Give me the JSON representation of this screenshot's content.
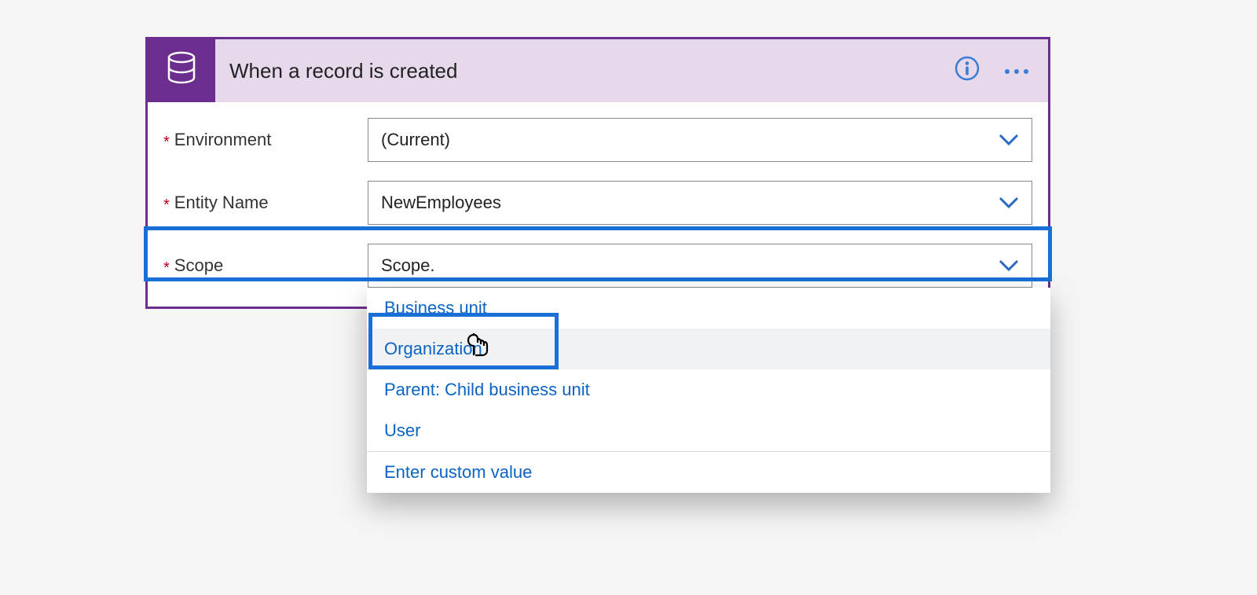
{
  "card": {
    "title": "When a record is created",
    "fields": {
      "environment": {
        "label": "Environment",
        "value": "(Current)"
      },
      "entity": {
        "label": "Entity Name",
        "value": "NewEmployees"
      },
      "scope": {
        "label": "Scope",
        "value": "Scope."
      }
    }
  },
  "dropdown": {
    "options": {
      "0": "Business unit",
      "1": "Organization",
      "2": "Parent: Child business unit",
      "3": "User"
    },
    "custom": "Enter custom value"
  }
}
